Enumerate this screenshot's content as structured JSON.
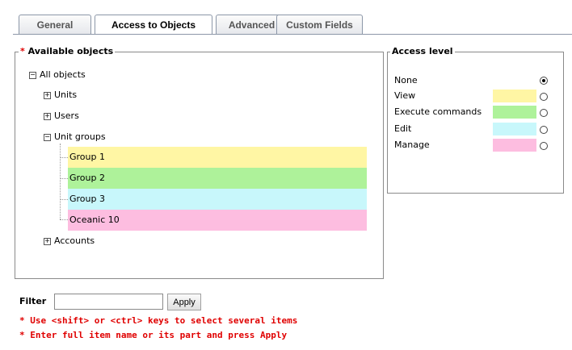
{
  "tabs": [
    {
      "label": "General",
      "active": false
    },
    {
      "label": "Access to Objects",
      "active": true
    },
    {
      "label": "Advanced",
      "active": false
    },
    {
      "label": "Custom Fields",
      "active": false
    }
  ],
  "objects_panel": {
    "required_mark": "*",
    "title": "Available objects",
    "tree": {
      "root": {
        "label": "All objects",
        "expander": "−"
      },
      "units": {
        "label": "Units",
        "expander": "+"
      },
      "users": {
        "label": "Users",
        "expander": "+"
      },
      "unit_groups": {
        "label": "Unit groups",
        "expander": "−"
      },
      "groups": [
        {
          "label": "Group 1",
          "color": "#fff6a4"
        },
        {
          "label": "Group 2",
          "color": "#aef29a"
        },
        {
          "label": "Group 3",
          "color": "#c8f7fb"
        },
        {
          "label": "Oceanic 10",
          "color": "#fdbde0"
        }
      ],
      "accounts": {
        "label": "Accounts",
        "expander": "+"
      }
    }
  },
  "access_panel": {
    "title": "Access level",
    "levels": [
      {
        "label": "None",
        "color": "",
        "checked": true
      },
      {
        "label": "View",
        "color": "#fff6a4",
        "checked": false
      },
      {
        "label": "Execute commands",
        "color": "#aef29a",
        "checked": false
      },
      {
        "label": "Edit",
        "color": "#c8f7fb",
        "checked": false
      },
      {
        "label": "Manage",
        "color": "#fdbde0",
        "checked": false
      }
    ]
  },
  "filter": {
    "label": "Filter",
    "value": "",
    "apply_label": "Apply"
  },
  "hints": [
    "* Use <shift> or <ctrl> keys to select several items",
    "* Enter full item name or its part and press Apply"
  ]
}
